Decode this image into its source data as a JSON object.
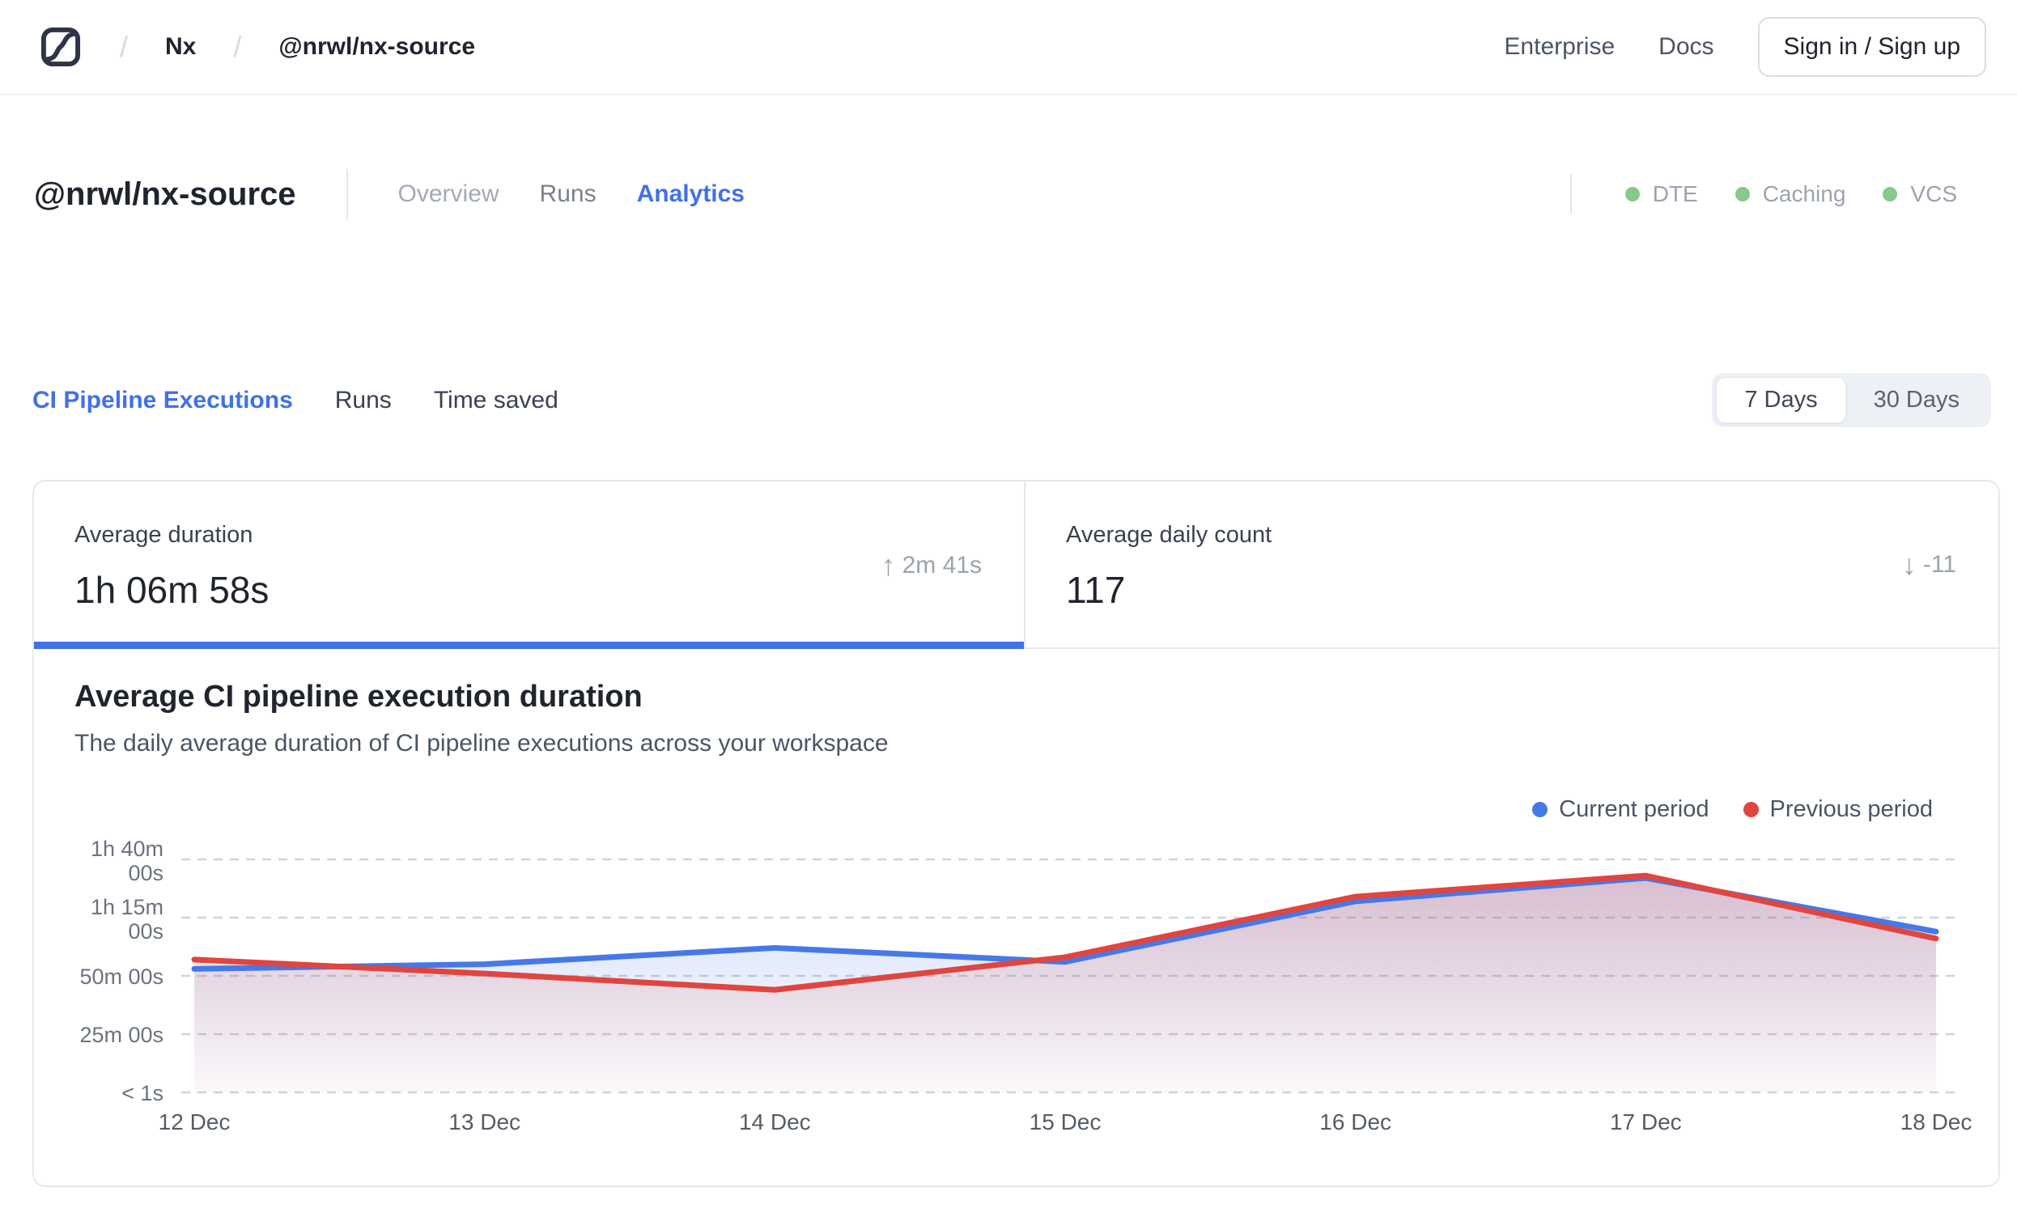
{
  "colors": {
    "accent_blue": "#4170E8",
    "status_green": "#86C98B",
    "chart_blue": "#4678E8",
    "chart_red": "#E0453F"
  },
  "navbar": {
    "logo": "nx-cloud-logo",
    "separator": "/",
    "breadcrumb": [
      "Nx",
      "@nrwl/nx-source"
    ],
    "links": [
      "Enterprise",
      "Docs"
    ],
    "signin_label": "Sign in / Sign up"
  },
  "workspace_header": {
    "title": "@nrwl/nx-source",
    "tabs": [
      {
        "label": "Overview",
        "active": false
      },
      {
        "label": "Runs",
        "active": false
      },
      {
        "label": "Analytics",
        "active": true
      }
    ],
    "statuses": [
      {
        "label": "DTE"
      },
      {
        "label": "Caching"
      },
      {
        "label": "VCS"
      }
    ]
  },
  "section_tabs": [
    {
      "label": "CI Pipeline Executions",
      "active": true
    },
    {
      "label": "Runs",
      "active": false
    },
    {
      "label": "Time saved",
      "active": false
    }
  ],
  "range_toggle": {
    "options": [
      "7 Days",
      "30 Days"
    ],
    "selected": "7 Days"
  },
  "stats": {
    "up_arrow": "↑",
    "down_arrow": "↓",
    "cards": [
      {
        "label": "Average duration",
        "value": "1h 06m 58s",
        "delta": "2m 41s",
        "direction": "up",
        "selected": true
      },
      {
        "label": "Average daily count",
        "value": "117",
        "delta": "-11",
        "direction": "down",
        "selected": false
      }
    ]
  },
  "chart_data": {
    "type": "line",
    "title": "Average CI pipeline execution duration",
    "subtitle": "The daily average duration of CI pipeline executions across your workspace",
    "x": [
      "12 Dec",
      "13 Dec",
      "14 Dec",
      "15 Dec",
      "16 Dec",
      "17 Dec",
      "18 Dec"
    ],
    "y_unit": "minutes",
    "ylim": [
      0,
      100
    ],
    "grid": "horizontal-dashed",
    "legend_position": "top-right",
    "y_ticks": [
      {
        "label_lines": [
          "1h 40m",
          "00s"
        ],
        "minutes": 100
      },
      {
        "label_lines": [
          "1h 15m",
          "00s"
        ],
        "minutes": 75
      },
      {
        "label_lines": [
          "50m 00s"
        ],
        "minutes": 50
      },
      {
        "label_lines": [
          "25m 00s"
        ],
        "minutes": 25
      },
      {
        "label_lines": [
          "< 1s"
        ],
        "minutes": 0
      }
    ],
    "series": [
      {
        "name": "Current period",
        "color": "#4678E8",
        "values_minutes": [
          53,
          55,
          62,
          56,
          82,
          92,
          69
        ]
      },
      {
        "name": "Previous period",
        "color": "#E0453F",
        "values_minutes": [
          57,
          51,
          44,
          58,
          84,
          93,
          66
        ]
      }
    ]
  }
}
